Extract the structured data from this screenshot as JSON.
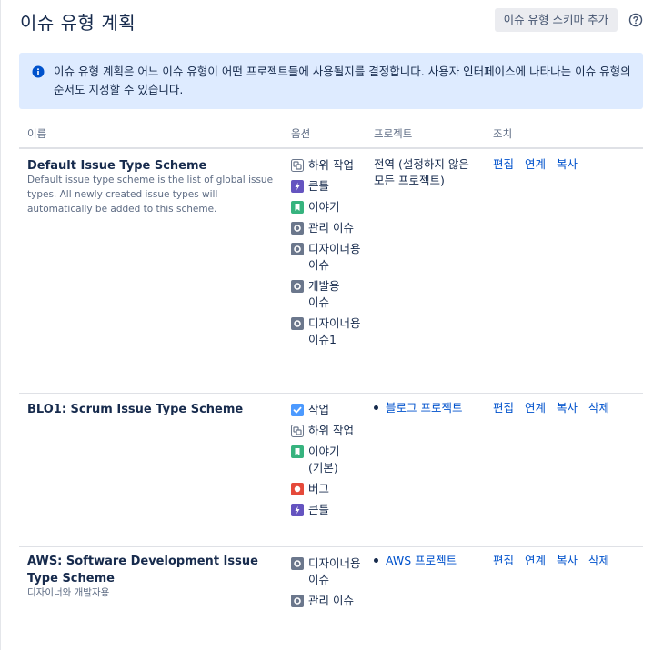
{
  "header": {
    "title": "이슈 유형 계획",
    "add_button": "이슈 유형 스키마 추가",
    "help_icon": "question-circle-icon"
  },
  "info": {
    "icon": "info-icon",
    "text": "이슈 유형 계획은 어느 이슈 유형이 어떤 프로젝트들에 사용될지를 결정합니다. 사용자 인터페이스에 나타나는 이슈 유형의 순서도 지정할 수 있습니다."
  },
  "table": {
    "columns": [
      "이름",
      "옵션",
      "프로젝트",
      "조치"
    ]
  },
  "colors": {
    "accent": "#0052cc",
    "subtask": "#6b778c",
    "epic": "#6554c0",
    "story": "#36b37e",
    "task": "#4c9aff",
    "bug": "#e5493a",
    "generic": "#6b778c",
    "banner": "#deebff"
  },
  "rows": [
    {
      "name": "Default Issue Type Scheme",
      "description": "Default issue type scheme is the list of global issue types. All newly created issue types will automatically be added to this scheme.",
      "options": [
        {
          "icon": "subtask-icon",
          "label": "하위 작업"
        },
        {
          "icon": "epic-icon",
          "label": "큰틀"
        },
        {
          "icon": "story-icon",
          "label": "이야기"
        },
        {
          "icon": "issue-type-icon",
          "label": "관리 이슈"
        },
        {
          "icon": "issue-type-icon",
          "label": "디자이너용 이슈"
        },
        {
          "icon": "issue-type-icon",
          "label": "개발용 이슈"
        },
        {
          "icon": "issue-type-icon",
          "label": "디자이너용 이슈1"
        }
      ],
      "project": "전역 (설정하지 않은 모든 프로젝트)",
      "actions": [
        "편집",
        "연계",
        "복사"
      ]
    },
    {
      "name": "BLO1: Scrum Issue Type Scheme",
      "description": "",
      "options": [
        {
          "icon": "task-icon",
          "label": "작업"
        },
        {
          "icon": "subtask-icon",
          "label": "하위 작업"
        },
        {
          "icon": "story-icon",
          "label": "이야기 (기본)"
        },
        {
          "icon": "bug-icon",
          "label": "버그"
        },
        {
          "icon": "epic-icon",
          "label": "큰틀"
        }
      ],
      "project": "블로그 프로젝트",
      "actions": [
        "편집",
        "연계",
        "복사",
        "삭제"
      ]
    },
    {
      "name": "AWS: Software Development Issue Type Scheme",
      "description": "디자이너와 개발자용",
      "options": [
        {
          "icon": "issue-type-icon",
          "label": "디자이너용 이슈"
        },
        {
          "icon": "issue-type-icon",
          "label": "관리 이슈"
        }
      ],
      "project": "AWS 프로젝트",
      "actions": [
        "편집",
        "연계",
        "복사",
        "삭제"
      ]
    }
  ]
}
